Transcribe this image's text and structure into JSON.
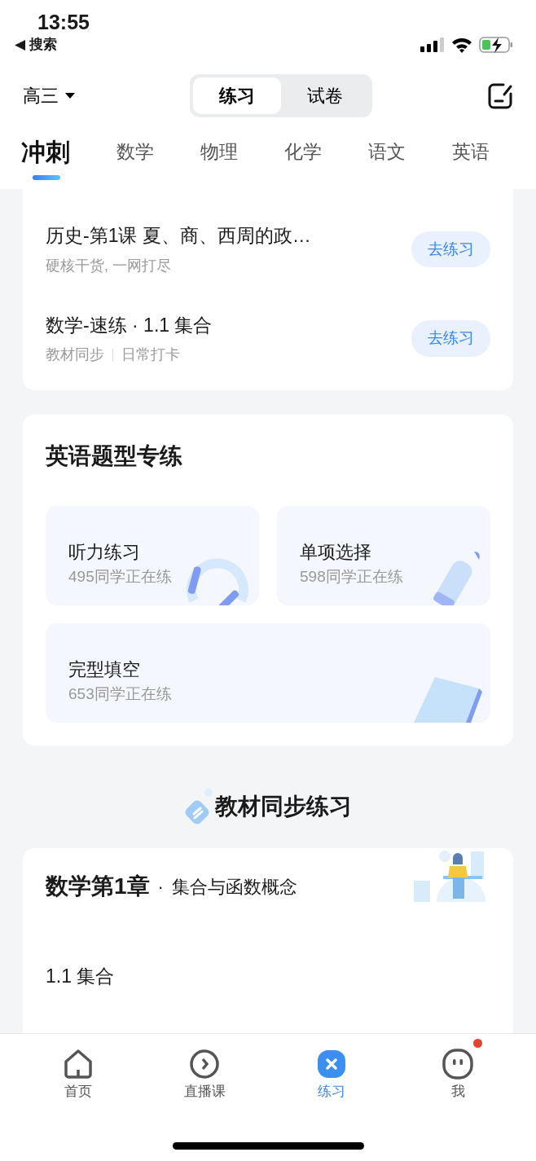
{
  "status_bar": {
    "time": "13:55",
    "back_label": "◀ 搜索"
  },
  "header": {
    "grade": "高三",
    "segments": [
      {
        "label": "练习",
        "selected": true
      },
      {
        "label": "试卷",
        "selected": false
      }
    ]
  },
  "subject_tabs": [
    {
      "label": "冲刺",
      "selected": true
    },
    {
      "label": "数学",
      "selected": false
    },
    {
      "label": "物理",
      "selected": false
    },
    {
      "label": "化学",
      "selected": false
    },
    {
      "label": "语文",
      "selected": false
    },
    {
      "label": "英语",
      "selected": false
    }
  ],
  "practice_list": [
    {
      "title": "历史-第1课 夏、商、西周的政…",
      "tags": [
        "硬核干货, 一网打尽"
      ],
      "button": "去练习"
    },
    {
      "title": "数学-速练 · 1.1 集合",
      "tags": [
        "教材同步",
        "日常打卡"
      ],
      "button": "去练习"
    }
  ],
  "english_section": {
    "title": "英语题型专练",
    "cards": [
      {
        "title": "听力练习",
        "count": "495同学正在练",
        "kind": "headphones"
      },
      {
        "title": "单项选择",
        "count": "598同学正在练",
        "kind": "pencil"
      },
      {
        "title": "完型填空",
        "count": "653同学正在练",
        "kind": "book"
      }
    ]
  },
  "textbook_section": {
    "title": "教材同步练习",
    "chapter": {
      "title": "数学第1章",
      "separator": "·",
      "subtitle": "集合与函数概念",
      "lessons": [
        "1.1 集合"
      ]
    }
  },
  "bottom_nav": [
    {
      "label": "首页",
      "kind": "home",
      "selected": false,
      "dot": false
    },
    {
      "label": "直播课",
      "kind": "live",
      "selected": false,
      "dot": false
    },
    {
      "label": "练习",
      "kind": "practice",
      "selected": true,
      "dot": false
    },
    {
      "label": "我",
      "kind": "me",
      "selected": false,
      "dot": true
    }
  ]
}
